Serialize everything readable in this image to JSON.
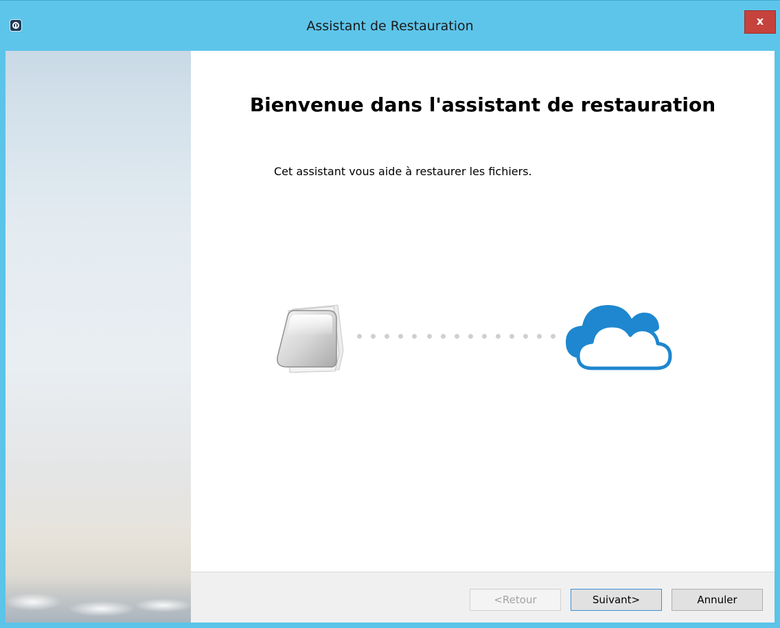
{
  "window": {
    "title": "Assistant de Restauration",
    "close_label": "x",
    "title_bar_color": "#5ec5ea",
    "close_button_color": "#c6423c"
  },
  "icons": {
    "app": "app-logo-icon",
    "documents": "documents-icon",
    "cloud": "cloud-icon",
    "close": "close-icon"
  },
  "main": {
    "heading": "Bienvenue dans l'assistant de restauration",
    "description": "Cet assistant vous aide à restaurer les fichiers."
  },
  "buttons": {
    "back_label": "<Retour",
    "back_enabled": false,
    "next_label": "Suivant>",
    "cancel_label": "Annuler"
  },
  "colors": {
    "accent_cloud": "#1e87cf",
    "dots": "#cdd0d2",
    "focus_border": "#3c8fd5"
  }
}
